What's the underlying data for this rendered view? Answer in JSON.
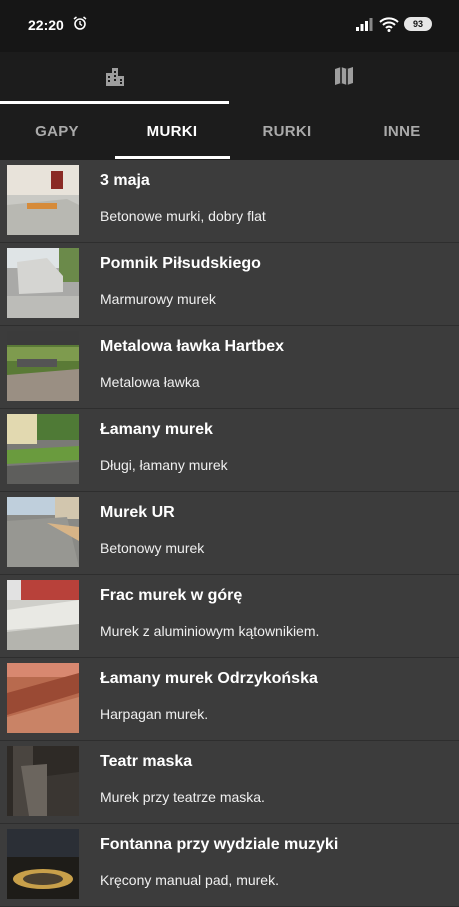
{
  "status_bar": {
    "time": "22:20",
    "battery": "93"
  },
  "top_tabs": [
    {
      "icon": "city-icon"
    },
    {
      "icon": "map-icon"
    }
  ],
  "sub_tabs": [
    "GAPY",
    "MURKI",
    "RURKI",
    "INNE"
  ],
  "active_sub_tab": "MURKI",
  "spots": [
    {
      "title": "3 maja",
      "description": "Betonowe murki, dobry flat"
    },
    {
      "title": "Pomnik Piłsudskiego",
      "description": "Marmurowy murek"
    },
    {
      "title": "Metalowa ławka Hartbex",
      "description": "Metalowa ławka"
    },
    {
      "title": "Łamany murek",
      "description": "Długi, łamany murek"
    },
    {
      "title": "Murek UR",
      "description": "Betonowy murek"
    },
    {
      "title": "Frac murek w górę",
      "description": "Murek z aluminiowym kątownikiem."
    },
    {
      "title": "Łamany murek Odrzykońska",
      "description": "Harpagan murek."
    },
    {
      "title": "Teatr maska",
      "description": "Murek przy teatrze maska."
    },
    {
      "title": "Fontanna przy wydziale muzyki",
      "description": "Kręcony manual pad, murek."
    }
  ]
}
